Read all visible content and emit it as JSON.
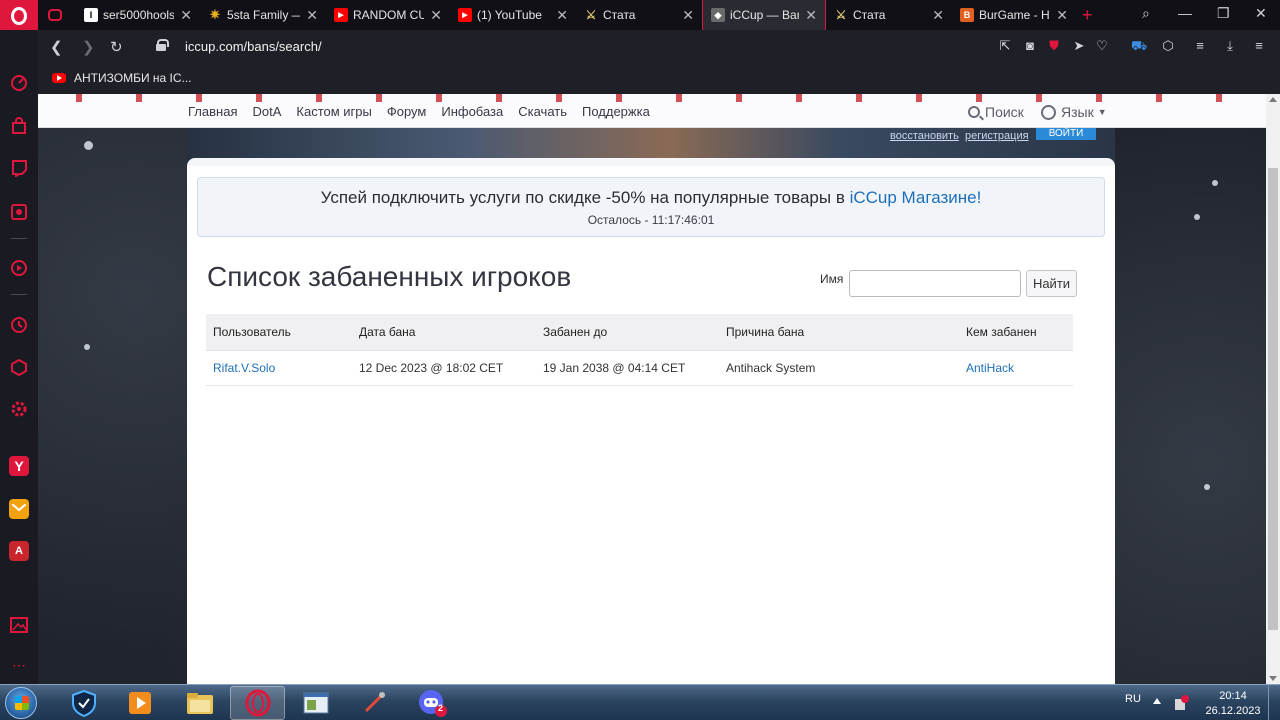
{
  "browser": {
    "tabs": [
      {
        "title": "",
        "icon_color": "#e0173c",
        "icon": "game-controller-icon"
      },
      {
        "title": "ser5000hools:",
        "icon_color": "#ffffff",
        "icon": "site-icon"
      },
      {
        "title": "5sta Family —",
        "icon_color": "#e8b020",
        "icon": "star-icon"
      },
      {
        "title": "RANDOM CUP",
        "icon_color": "#ff0000",
        "icon": "youtube-icon"
      },
      {
        "title": "(1) YouTube",
        "icon_color": "#ff0000",
        "icon": "youtube-icon"
      },
      {
        "title": "Стата",
        "icon_color": "#d8c070",
        "icon": "crossed-swords-icon"
      },
      {
        "title": "iCCup — Bans",
        "icon_color": "#8a8a8a",
        "icon": "iccup-icon"
      },
      {
        "title": "Стата",
        "icon_color": "#d8c070",
        "icon": "crossed-swords-icon"
      },
      {
        "title": "BurGame - Ho",
        "icon_color": "#e06020",
        "icon": "burgame-icon"
      }
    ],
    "url": "iccup.com/bans/search/",
    "bookmark": "АНТИЗОМБИ на IC..."
  },
  "site": {
    "nav": [
      "Главная",
      "DotA",
      "Кастом игры",
      "Форум",
      "Инфобаза",
      "Скачать",
      "Поддержка"
    ],
    "search_label": "Поиск",
    "lang_label": "Язык",
    "account": {
      "restore": "восстановить",
      "register": "регистрация",
      "login": "ВОЙТИ"
    }
  },
  "promo": {
    "text": "Успей подключить услуги по скидке -50% на популярные товары в ",
    "link": "iCCup Магазине!",
    "timer": "Осталось - 11:17:46:01"
  },
  "main": {
    "title": "Список забаненных игроков",
    "search": {
      "label": "Имя",
      "value": "",
      "placeholder": "",
      "button": "Найти"
    },
    "table": {
      "headers": [
        "Пользователь",
        "Дата бана",
        "Забанен до",
        "Причина бана",
        "Кем забанен"
      ],
      "rows": [
        [
          "Rifat.V.Solo",
          "12 Dec 2023 @ 18:02 CET",
          "19 Jan 2038 @ 04:14 CET",
          "Antihack System",
          "AntiHack"
        ]
      ]
    }
  },
  "taskbar": {
    "lang": "RU",
    "time": "20:14",
    "date": "26.12.2023",
    "discord_badge": "2"
  },
  "colors": {
    "accent": "#e0173c",
    "link": "#1d6fb8"
  }
}
